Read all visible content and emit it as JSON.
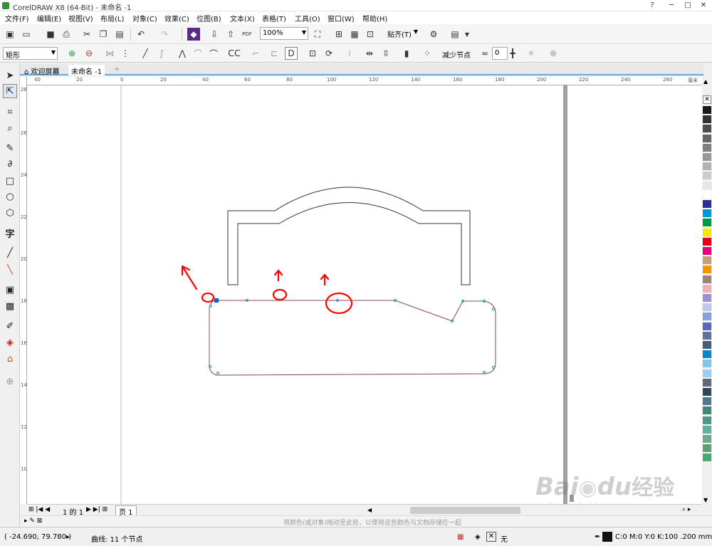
{
  "window": {
    "title": "CorelDRAW X8 (64-Bit) - 未命名 -1",
    "controls": [
      "?",
      "─",
      "□",
      "✕"
    ]
  },
  "menu": [
    "文件(F)",
    "编辑(E)",
    "视图(V)",
    "布局(L)",
    "对象(C)",
    "效果(C)",
    "位图(B)",
    "文本(X)",
    "表格(T)",
    "工具(O)",
    "窗口(W)",
    "帮助(H)"
  ],
  "toolbar": {
    "zoom": "100%",
    "snap_label": "贴齐(T)",
    "pdf_label": "PDF"
  },
  "property_bar": {
    "shape_select": "矩形",
    "reduce_nodes_label": "减少节点",
    "smoothness_value": "0"
  },
  "tabs": [
    {
      "label": "欢迎屏幕"
    },
    {
      "label": "未命名 -1"
    }
  ],
  "hruler_labels": [
    "40",
    "20",
    "0",
    "20",
    "40",
    "60",
    "80",
    "100",
    "120",
    "140",
    "160",
    "180",
    "200",
    "220",
    "240",
    "260"
  ],
  "hruler_unit": "毫米",
  "vruler_labels": [
    "280",
    "260",
    "240",
    "220",
    "200",
    "180",
    "160",
    "140",
    "120",
    "100"
  ],
  "page_nav": {
    "page_text": "1 的 1",
    "page_tab": "页 1"
  },
  "hint_text": "将颜色(或对象)拖动至此处，以便将这些颜色与文档存储在一起",
  "status": {
    "coords": "( -24.690, 79.780 )",
    "object_info": "曲线: 11 个节点",
    "fill_none": "无",
    "outline_info": "C:0 M:0 Y:0 K:100  .200 mm"
  },
  "watermark": {
    "brand": "Bai",
    "brand2": "du",
    "cn": "经验",
    "url": "jingyan.baidu.com"
  },
  "palette_colors": [
    "#ffffff",
    "#1a1a1a",
    "#333333",
    "#4d4d4d",
    "#666666",
    "#808080",
    "#999999",
    "#b3b3b3",
    "#cccccc",
    "#e6e6e6",
    "#ffffff",
    "#2b2f8f",
    "#0099d8",
    "#009944",
    "#ffe600",
    "#e60012",
    "#e4007f",
    "#c8a078",
    "#f39800",
    "#a08078",
    "#f2b0b8",
    "#9f8fd0",
    "#c0c8e8",
    "#8aa0d8",
    "#5868b8",
    "#6070a0",
    "#485c78",
    "#0088c8",
    "#80c8e8",
    "#98d0f0",
    "#606878",
    "#304858",
    "#507890",
    "#408878",
    "#4a9890",
    "#60b0a0",
    "#70a888",
    "#60a070",
    "#48a870"
  ],
  "annotation_color": "#ff0000"
}
